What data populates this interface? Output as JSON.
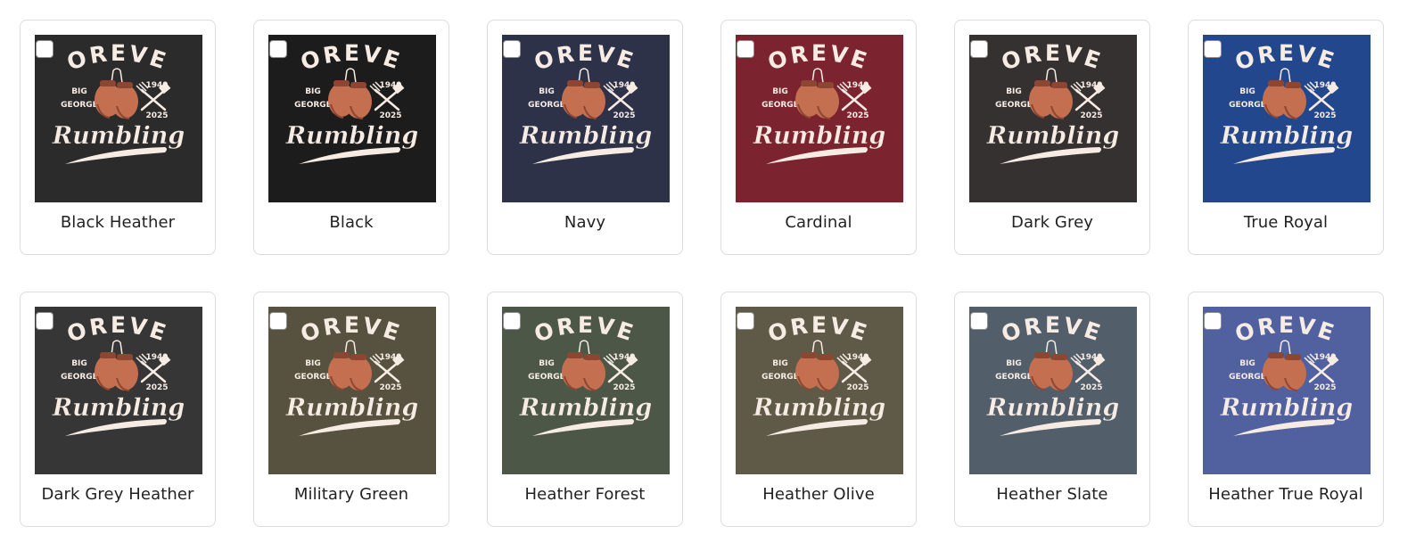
{
  "design": {
    "title": "FOREVER",
    "left_text_line1": "BIG",
    "left_text_line2": "GEORGE",
    "year_top": "1949",
    "year_bottom": "2025",
    "script_text": "Rumbling"
  },
  "colors": {
    "print_text": "#f7ece4",
    "glove": "#c46f4f",
    "glove_shadow": "#8d4631",
    "card_border": "#dcdcdc",
    "label_text": "#222222"
  },
  "swatches": [
    {
      "name": "Black Heather",
      "color": "#2c2b2b",
      "checked": false
    },
    {
      "name": "Black",
      "color": "#1c1c1c",
      "checked": false
    },
    {
      "name": "Navy",
      "color": "#2e3249",
      "checked": false
    },
    {
      "name": "Cardinal",
      "color": "#7b232e",
      "checked": false
    },
    {
      "name": "Dark Grey",
      "color": "#353131",
      "checked": false
    },
    {
      "name": "True Royal",
      "color": "#22478c",
      "checked": false
    },
    {
      "name": "Dark Grey Heather",
      "color": "#363636",
      "checked": false
    },
    {
      "name": "Military Green",
      "color": "#56523f",
      "checked": false
    },
    {
      "name": "Heather Forest",
      "color": "#4c5748",
      "checked": false
    },
    {
      "name": "Heather Olive",
      "color": "#5e5a47",
      "checked": false
    },
    {
      "name": "Heather Slate",
      "color": "#535e6b",
      "checked": false
    },
    {
      "name": "Heather True Royal",
      "color": "#51609e",
      "checked": false
    }
  ]
}
